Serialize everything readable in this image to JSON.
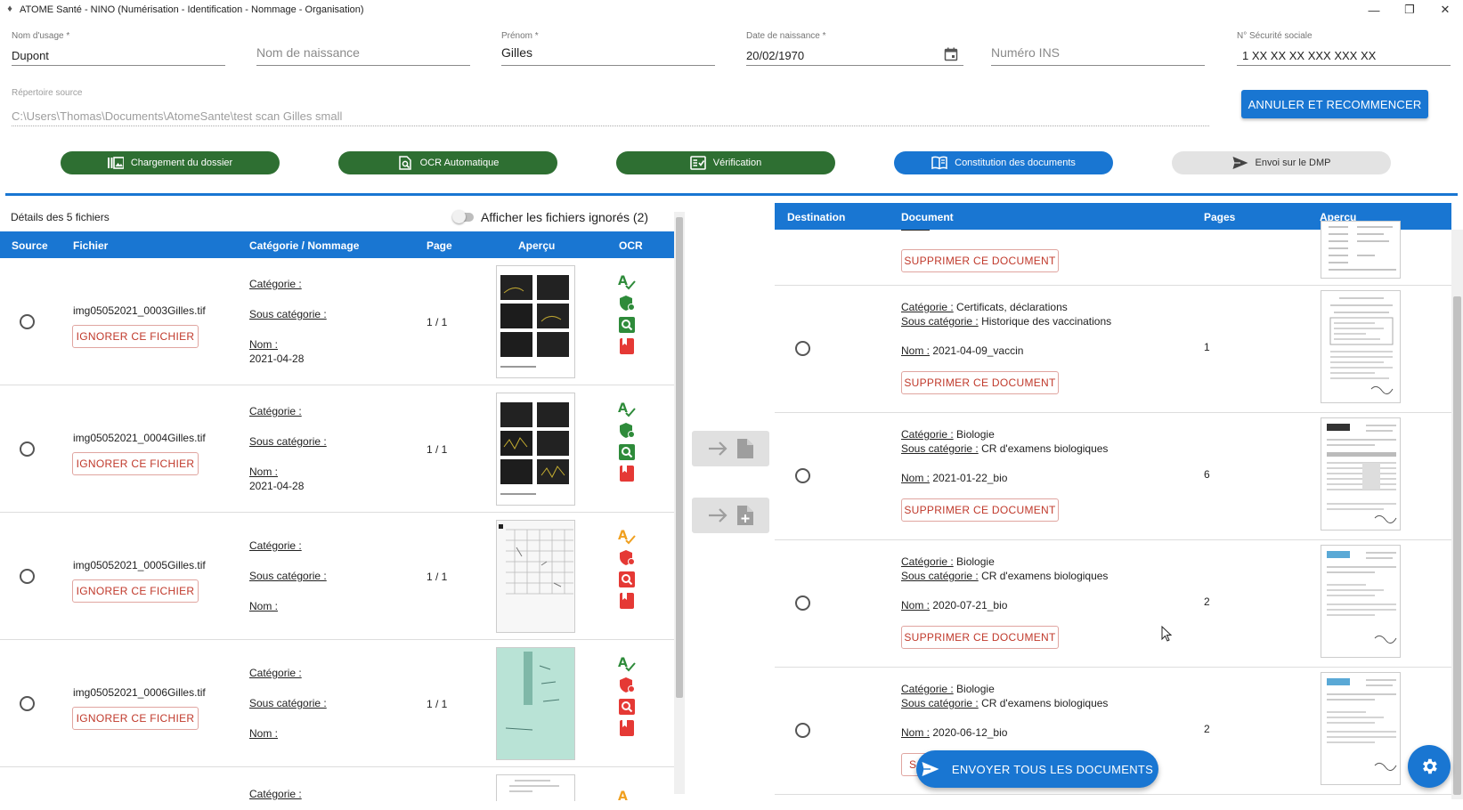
{
  "window": {
    "title": "ATOME Santé - NINO (Numérisation - Identification - Nommage - Organisation)",
    "minimize": "—",
    "maximize": "❐",
    "close": "✕"
  },
  "patient": {
    "nom_usage": {
      "label": "Nom d'usage *",
      "value": "Dupont"
    },
    "nom_naissance": {
      "placeholder": "Nom de naissance"
    },
    "prenom": {
      "label": "Prénom *",
      "value": "Gilles"
    },
    "date_naissance": {
      "label": "Date de naissance *",
      "value": "20/02/1970"
    },
    "ins": {
      "placeholder": "Numéro INS"
    },
    "secu": {
      "label": "N° Sécurité sociale",
      "value": "1 XX XX XX XXX XXX XX"
    }
  },
  "source": {
    "label": "Répertoire source",
    "value": "C:\\Users\\Thomas\\Documents\\AtomeSante\\test scan Gilles small"
  },
  "cancel_button": "ANNULER ET RECOMMENCER",
  "steps": [
    {
      "label": "Chargement du dossier",
      "state": "done"
    },
    {
      "label": "OCR Automatique",
      "state": "done"
    },
    {
      "label": "Vérification",
      "state": "done"
    },
    {
      "label": "Constitution des documents",
      "state": "active"
    },
    {
      "label": "Envoi sur le DMP",
      "state": "pending"
    }
  ],
  "left": {
    "details": "Détails des 5 fichiers",
    "toggle_label": "Afficher les fichiers ignorés (2)",
    "headers": {
      "source": "Source",
      "fichier": "Fichier",
      "categorie": "Catégorie / Nommage",
      "page": "Page",
      "apercu": "Aperçu",
      "ocr": "OCR"
    },
    "labels": {
      "categorie": "Catégorie :",
      "sous_categorie": "Sous catégorie :",
      "nom": "Nom :",
      "ignore": "IGNORER CE FICHIER"
    },
    "rows": [
      {
        "file": "img05052021_0003Gilles.tif",
        "page": "1 / 1",
        "nom_value": "2021-04-28",
        "ocr": "ok"
      },
      {
        "file": "img05052021_0004Gilles.tif",
        "page": "1 / 1",
        "nom_value": "2021-04-28",
        "ocr": "ok"
      },
      {
        "file": "img05052021_0005Gilles.tif",
        "page": "1 / 1",
        "nom_value": "",
        "ocr": "warn"
      },
      {
        "file": "img05052021_0006Gilles.tif",
        "page": "1 / 1",
        "nom_value": "",
        "ocr": "ok"
      }
    ],
    "partial_row": {
      "categorie": "Catégorie :"
    }
  },
  "right": {
    "headers": {
      "destination": "Destination",
      "document": "Document",
      "pages": "Pages",
      "apercu": "Aperçu"
    },
    "labels": {
      "categorie": "Catégorie :",
      "sous_categorie": "Sous catégorie :",
      "nom": "Nom :",
      "delete": "SUPPRIMER CE DOCUMENT",
      "delete_partial": "S"
    },
    "rows": [
      {
        "categorie": "Certificats, déclarations",
        "sous_categorie": "Historique des vaccinations",
        "nom": "2021-04-09_vaccin",
        "pages": "1"
      },
      {
        "categorie": "Biologie",
        "sous_categorie": "CR d'examens biologiques",
        "nom": "2021-01-22_bio",
        "pages": "6"
      },
      {
        "categorie": "Biologie",
        "sous_categorie": "CR d'examens biologiques",
        "nom": "2020-07-21_bio",
        "pages": "2"
      },
      {
        "categorie": "Biologie",
        "sous_categorie": "CR d'examens biologiques",
        "nom": "2020-06-12_bio",
        "pages": "2"
      }
    ]
  },
  "send_all": "ENVOYER TOUS LES DOCUMENTS",
  "colors": {
    "primary": "#1976d2",
    "step_done": "#2e6f32",
    "ocr_ok": "#2e8b3a",
    "ocr_warn": "#f0a020",
    "ocr_err": "#e53935"
  }
}
